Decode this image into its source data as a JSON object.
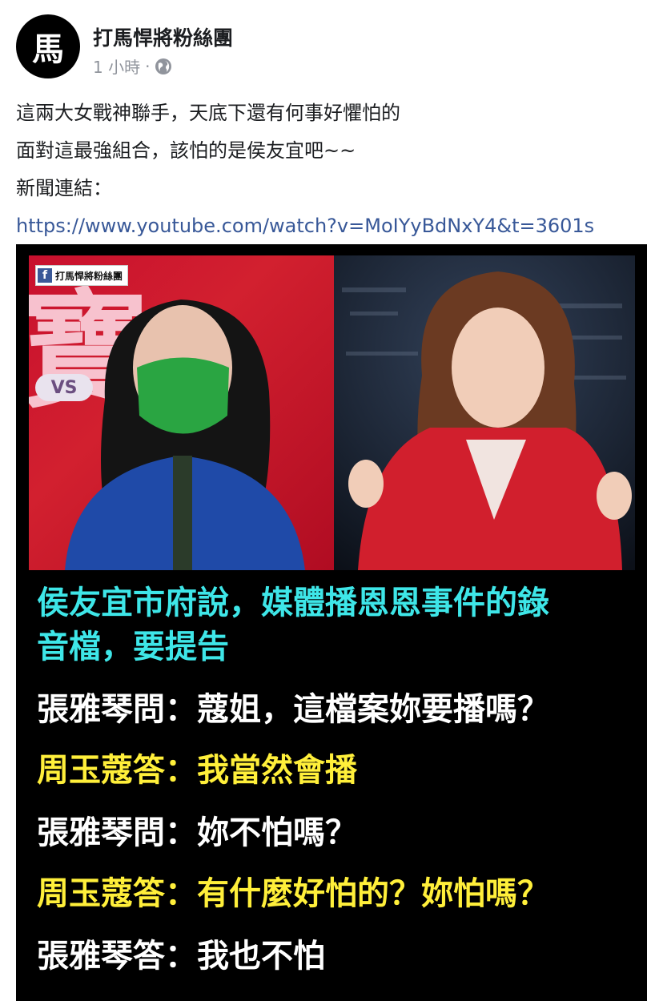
{
  "post": {
    "page_name": "打馬悍將粉絲團",
    "avatar_char": "馬",
    "time": "1 小時",
    "separator": "·",
    "privacy_icon": "globe-icon",
    "text_lines": [
      "這兩大女戰神聯手，天底下還有何事好懼怕的",
      "面對這最強組合，該怕的是侯友宜吧~~",
      "新聞連結："
    ],
    "link": "https://www.youtube.com/watch?v=MoIYyBdNxY4&t=3601s"
  },
  "image": {
    "watermark": "打馬悍將粉絲團",
    "watermark_icon": "facebook-icon",
    "bg_char": "寶",
    "vs_label": "VS",
    "captions": [
      {
        "text": "侯友宜市府說，媒體播恩恩事件的錄",
        "color": "cyan"
      },
      {
        "text": "音檔，要提告",
        "color": "cyan"
      },
      {
        "text": "張雅琴問：蔻姐，這檔案妳要播嗎？",
        "color": "white"
      },
      {
        "text": "周玉蔻答：我當然會播",
        "color": "yellow"
      },
      {
        "text": "張雅琴問：妳不怕嗎？",
        "color": "white"
      },
      {
        "text": "周玉蔻答：有什麼好怕的？妳怕嗎？",
        "color": "yellow"
      },
      {
        "text": "張雅琴答：我也不怕",
        "color": "white"
      }
    ],
    "colors": {
      "cyan": "#3ee6e8",
      "white": "#ffffff",
      "yellow": "#ffef3a"
    }
  }
}
